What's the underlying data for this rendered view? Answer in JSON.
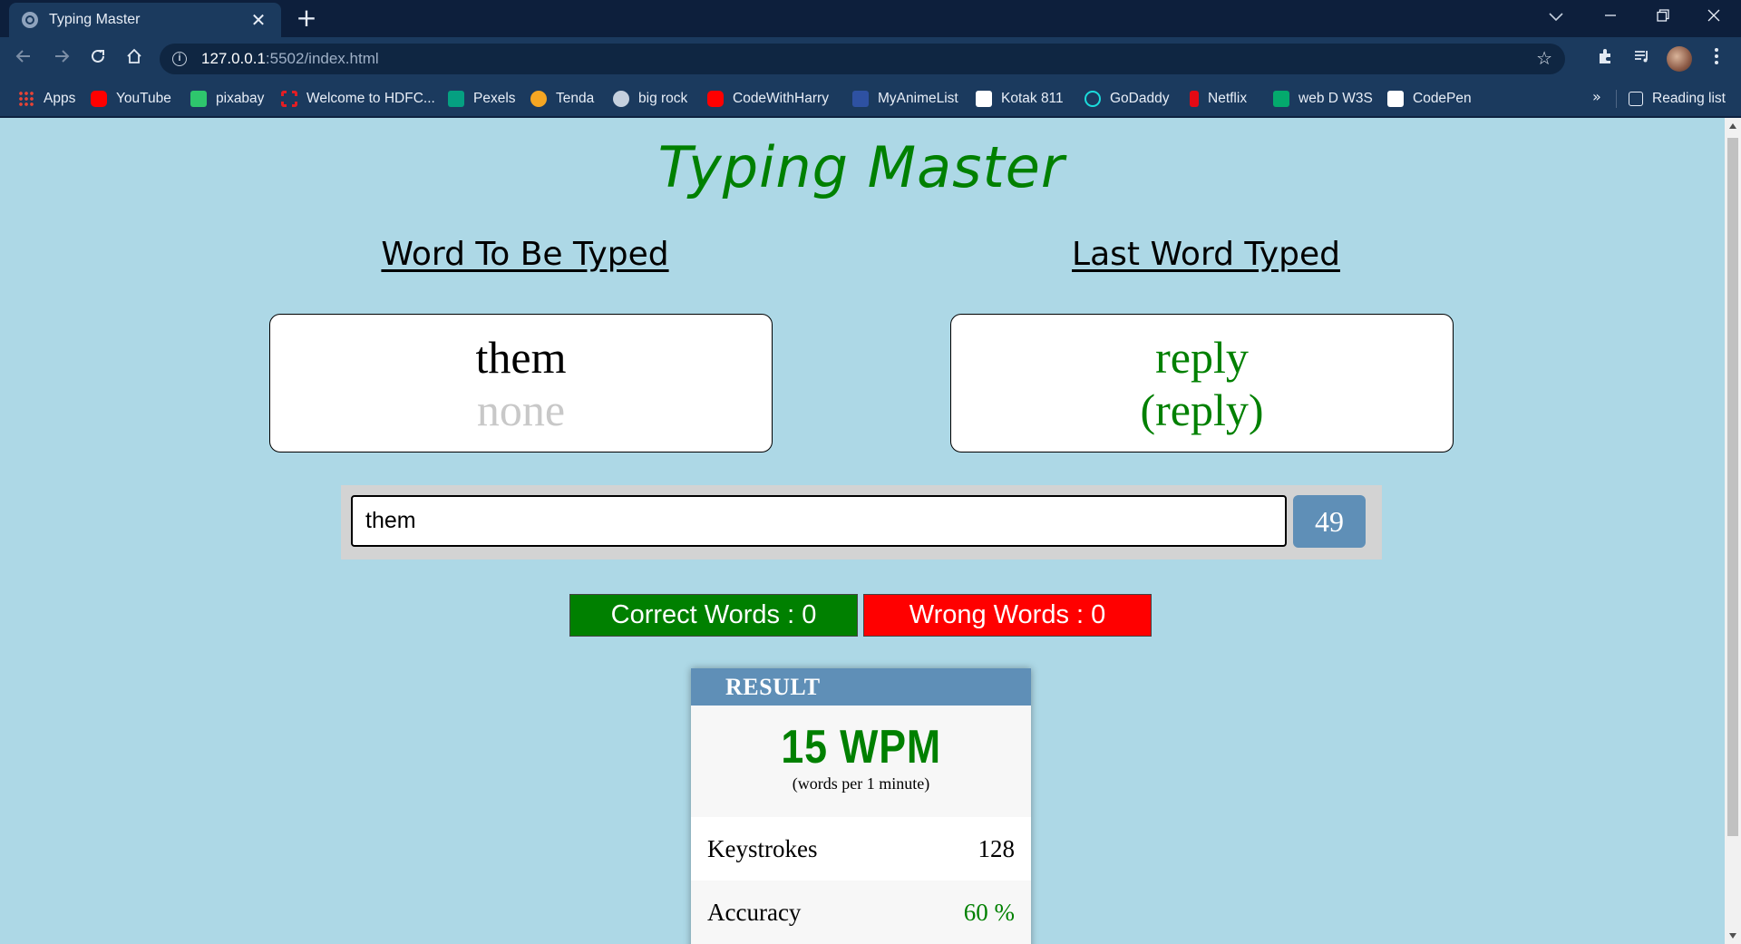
{
  "browser": {
    "tab_title": "Typing Master",
    "new_tab_label": "+",
    "url_host": "127.0.0.1",
    "url_path": ":5502/index.html",
    "bookmarks": [
      {
        "label": "Apps",
        "icon": "apps-grid-icon",
        "color": "#ea4335"
      },
      {
        "label": "YouTube",
        "icon": "youtube-icon",
        "color": "#ff0000"
      },
      {
        "label": "pixabay",
        "icon": "pixabay-icon",
        "color": "#2ec66d"
      },
      {
        "label": "Welcome to HDFC...",
        "icon": "hdfc-icon",
        "color": "#e31e24"
      },
      {
        "label": "Pexels",
        "icon": "pexels-icon",
        "color": "#05a081"
      },
      {
        "label": "Tenda",
        "icon": "tenda-icon",
        "color": "#f5a623"
      },
      {
        "label": "big rock",
        "icon": "globe-icon",
        "color": "#c5d0de"
      },
      {
        "label": "CodeWithHarry",
        "icon": "youtube-icon",
        "color": "#ff0000"
      },
      {
        "label": "MyAnimeList",
        "icon": "myanimelist-icon",
        "color": "#2e51a2"
      },
      {
        "label": "Kotak 811",
        "icon": "kotak-icon",
        "color": "#ffffff"
      },
      {
        "label": "GoDaddy",
        "icon": "godaddy-icon",
        "color": "#1bdbdb"
      },
      {
        "label": "Netflix",
        "icon": "netflix-icon",
        "color": "#e50914"
      },
      {
        "label": "web D W3S",
        "icon": "w3schools-icon",
        "color": "#04aa6d"
      },
      {
        "label": "CodePen",
        "icon": "codepen-icon",
        "color": "#ffffff"
      }
    ],
    "more_label": "»",
    "reading_list_label": "Reading list"
  },
  "app": {
    "title": "Typing Master",
    "left_heading": "Word To Be Typed",
    "right_heading": "Last Word Typed",
    "current_word": "them",
    "next_word": "none",
    "last_word": "reply",
    "last_word_typed": "(reply)",
    "input_value": "them",
    "timer": "49",
    "correct_label": "Correct Words : 0",
    "wrong_label": "Wrong Words : 0",
    "result": {
      "heading": "RESULT",
      "wpm": "15 WPM",
      "wpm_sub": "(words per 1 minute)",
      "keystrokes_label": "Keystrokes",
      "keystrokes_value": "128",
      "accuracy_label": "Accuracy",
      "accuracy_value": "60 %"
    }
  },
  "colors": {
    "page_bg": "#add8e6",
    "title_green": "#008000",
    "correct_bg": "#008000",
    "wrong_bg": "#ff0000",
    "accent_blue": "#5f8fb7"
  }
}
